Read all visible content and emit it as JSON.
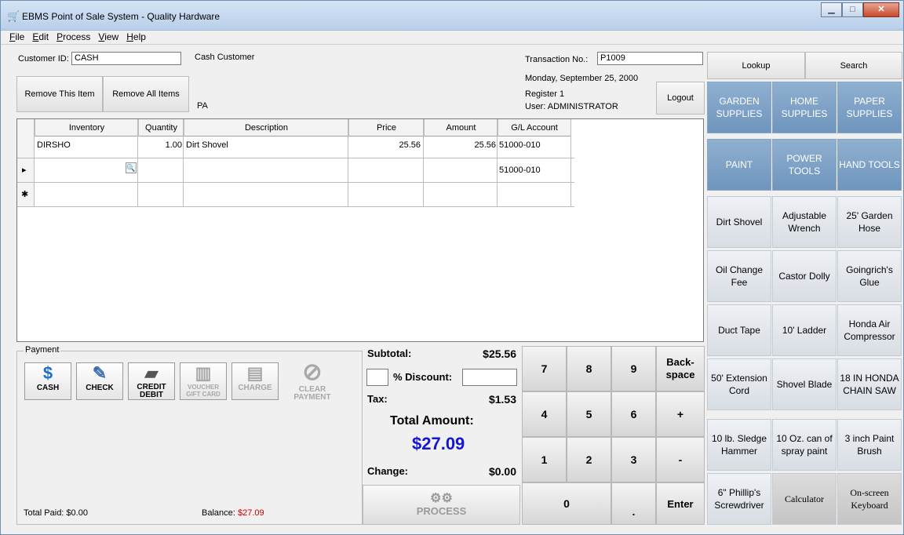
{
  "window": {
    "title": "EBMS Point of Sale System - Quality Hardware",
    "min": "▁",
    "max": "□",
    "close": "✕"
  },
  "menu": [
    {
      "pre": "",
      "u": "F",
      "post": "ile"
    },
    {
      "pre": "",
      "u": "E",
      "post": "dit"
    },
    {
      "pre": "",
      "u": "P",
      "post": "rocess"
    },
    {
      "pre": "",
      "u": "V",
      "post": "iew"
    },
    {
      "pre": "",
      "u": "H",
      "post": "elp"
    }
  ],
  "customer": {
    "id_label": "Customer ID:",
    "id_value": "CASH",
    "name": "Cash Customer",
    "state": "PA"
  },
  "transaction": {
    "label": "Transaction No.:",
    "value": "P1009",
    "date": "Monday, September 25, 2000",
    "register": "Register 1",
    "user": "User: ADMINISTRATOR"
  },
  "buttons": {
    "remove_item": "Remove This Item",
    "remove_all": "Remove All Items",
    "logout": "Logout",
    "lookup": "Lookup",
    "search": "Search"
  },
  "grid": {
    "columns": [
      "Inventory",
      "Quantity",
      "Description",
      "Price",
      "Amount",
      "G/L Account"
    ],
    "rows": [
      {
        "inventory": "DIRSHO",
        "quantity": "1.00",
        "description": "Dirt Shovel",
        "price": "25.56",
        "amount": "25.56",
        "gl": "51000-010"
      },
      {
        "inventory": "",
        "quantity": "",
        "description": "",
        "price": "",
        "amount": "",
        "gl": "51000-010"
      }
    ],
    "current_marker": "▸",
    "new_marker": "✱"
  },
  "payment": {
    "legend": "Payment",
    "methods": [
      {
        "label": "CASH",
        "icon": "$"
      },
      {
        "label": "CHECK",
        "icon": "✎"
      },
      {
        "label": "CREDIT DEBIT",
        "icon": "▰"
      },
      {
        "label": "VOUCHER GIFT CARD",
        "icon": "▥"
      },
      {
        "label": "CHARGE",
        "icon": "▤"
      },
      {
        "label": "CLEAR PAYMENT",
        "icon": "⊘"
      }
    ],
    "total_paid": "Total Paid: $0.00",
    "balance_label": "Balance:",
    "balance_value": "$27.09"
  },
  "totals": {
    "subtotal_label": "Subtotal:",
    "subtotal": "$25.56",
    "discount_label": "% Discount:",
    "tax_label": "Tax:",
    "tax": "$1.53",
    "total_label": "Total Amount:",
    "total": "$27.09",
    "change_label": "Change:",
    "change": "$0.00",
    "process": "PROCESS"
  },
  "keypad": [
    "7",
    "8",
    "9",
    "Back-space",
    "4",
    "5",
    "6",
    "+",
    "1",
    "2",
    "3",
    "-",
    "0",
    ".",
    "Enter"
  ],
  "categories": [
    "GARDEN SUPPLIES",
    "HOME SUPPLIES",
    "PAPER SUPPLIES",
    "PAINT",
    "POWER TOOLS",
    "HAND TOOLS"
  ],
  "items": [
    "Dirt Shovel",
    "Adjustable Wrench",
    "25' Garden Hose",
    "Oil Change Fee",
    "Castor Dolly",
    "Goingrich's Glue",
    "Duct Tape",
    "10' Ladder",
    "Honda Air Compressor",
    "50' Extension Cord",
    "Shovel Blade",
    "18 IN HONDA CHAIN SAW",
    "10 lb. Sledge Hammer",
    "10 Oz. can of spray paint",
    "3 inch Paint Brush",
    "6\" Phillip's Screwdriver"
  ],
  "tools": [
    "Calculator",
    "On-screen Keyboard"
  ],
  "colors": {
    "balance": "#cc0000",
    "total": "#1515d4",
    "category": "#7ba0c6"
  }
}
